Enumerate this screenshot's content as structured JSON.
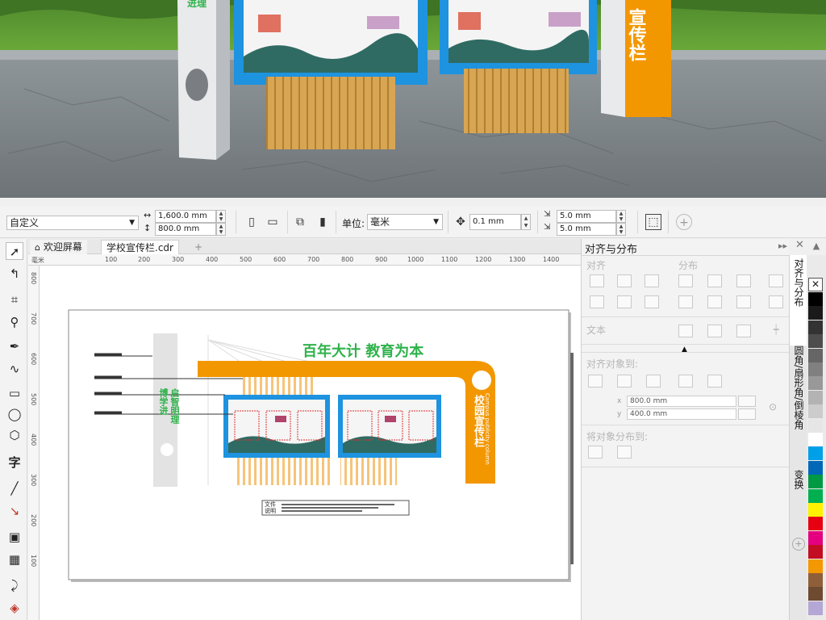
{
  "property_bar": {
    "preset": "自定义",
    "width": "1,600.0 mm",
    "height": "800.0 mm",
    "units_label": "单位:",
    "units_value": "毫米",
    "nudge": "0.1 mm",
    "dup_x": "5.0 mm",
    "dup_y": "5.0 mm"
  },
  "tabs": [
    {
      "label": "欢迎屏幕"
    },
    {
      "label": "学校宣传栏.cdr"
    }
  ],
  "ruler": {
    "unit": "毫米",
    "h_ticks": [
      "100",
      "200",
      "300",
      "400",
      "500",
      "600",
      "700",
      "800",
      "900",
      "1000",
      "1100",
      "1200",
      "1300",
      "1400"
    ],
    "v_ticks": [
      "800",
      "700",
      "600",
      "500",
      "400",
      "300",
      "200",
      "100"
    ]
  },
  "design": {
    "slogan": "百年大计 教育为本",
    "panel_title": "校园宣传栏",
    "panel_subtitle": "Campus publicity column",
    "pillar_text_left": "博学进",
    "pillar_text_right": "启智明理",
    "plate_label": "文件说明"
  },
  "docker": {
    "title": "对齐与分布",
    "align_label": "对齐",
    "distribute_label": "分布",
    "text_label": "文本",
    "align_to_label": "对齐对象到:",
    "x_value": "800.0 mm",
    "y_value": "400.0 mm",
    "distribute_to_label": "将对象分布到:"
  },
  "side_tabs": [
    {
      "label": "对齐与分布"
    },
    {
      "label": "圆角/扇形角/倒棱角"
    },
    {
      "label": "变换"
    }
  ],
  "palette_colors": [
    "#ffffff",
    "#000000",
    "#1a1a1a",
    "#333333",
    "#4d4d4d",
    "#666666",
    "#808080",
    "#999999",
    "#b3b3b3",
    "#cccccc",
    "#e6e6e6",
    "#ffffff",
    "#00a0e9",
    "#0068b7",
    "#009944",
    "#00b050",
    "#fff100",
    "#e60012",
    "#e4007f",
    "#c30d23",
    "#f39800",
    "#8f5f3a",
    "#6e4a30",
    "#b4a7d6"
  ],
  "colors": {
    "orange": "#f39700",
    "blue": "#1e93df",
    "green": "#2fb24b",
    "wood": "#e2a84c"
  }
}
